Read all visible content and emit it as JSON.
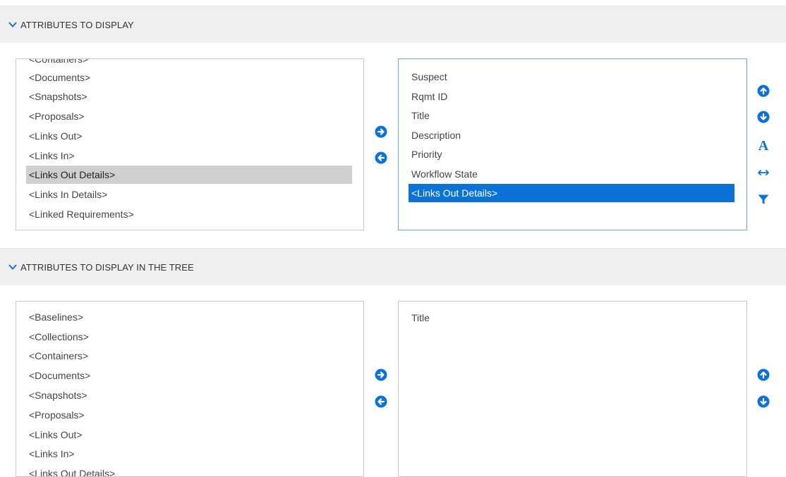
{
  "section1": {
    "title": "ATTRIBUTES TO DISPLAY",
    "available": [
      "<Containers>",
      "<Documents>",
      "<Snapshots>",
      "<Proposals>",
      "<Links Out>",
      "<Links In>",
      "<Links Out Details>",
      "<Links In Details>",
      "<Linked Requirements>"
    ],
    "available_selected": "<Links Out Details>",
    "selected": [
      "Suspect",
      "Rqmt ID",
      "Title",
      "Description",
      "Priority",
      "Workflow State",
      "<Links Out Details>"
    ],
    "selected_highlighted": "<Links Out Details>",
    "move_right_icon": "arrow-right-circle",
    "move_left_icon": "arrow-left-circle",
    "side_icons": [
      "arrow-up-circle",
      "arrow-down-circle",
      "font-A",
      "resize-horizontal",
      "filter-funnel"
    ]
  },
  "section2": {
    "title": "ATTRIBUTES TO DISPLAY IN THE TREE",
    "available": [
      "<Baselines>",
      "<Collections>",
      "<Containers>",
      "<Documents>",
      "<Snapshots>",
      "<Proposals>",
      "<Links Out>",
      "<Links In>",
      "<Links Out Details>"
    ],
    "selected": [
      "Title"
    ],
    "move_right_icon": "arrow-right-circle",
    "move_left_icon": "arrow-left-circle",
    "side_icons": [
      "arrow-up-circle",
      "arrow-down-circle"
    ]
  },
  "colors": {
    "accent": "#0b72d7",
    "header_bg": "#efefef",
    "selection_gray": "#cfcfcf",
    "focus_border": "#6aa6e8"
  }
}
